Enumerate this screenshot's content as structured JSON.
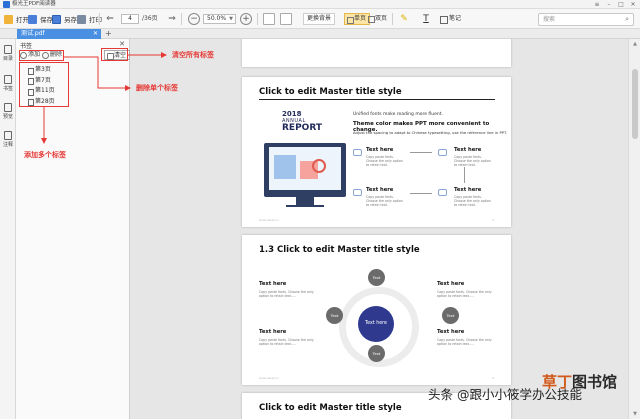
{
  "titlebar": {
    "title": "极光王PDF阅读器"
  },
  "toolbar": {
    "open_label": "打开",
    "save_label": "保存",
    "saveas_label": "另存",
    "print_label": "打印",
    "current_page": "4",
    "total_pages": "/36页",
    "zoom": "50.0%",
    "bg_label": "更换背景",
    "single_label": "单页",
    "double_label": "双页",
    "note_label": "笔记",
    "search_placeholder": "搜索"
  },
  "tabbar": {
    "tab_label": "测试.pdf"
  },
  "leftstrip": {
    "items": [
      "目录",
      "书签",
      "预览",
      "注释"
    ]
  },
  "bookmarks": {
    "title": "书签",
    "add_label": "添加",
    "delete_label": "删除",
    "clear_label": "清空",
    "items": [
      "第3页",
      "第7页",
      "第11页",
      "第28页"
    ]
  },
  "annotations": {
    "clear_all": "清空所有标签",
    "delete_single": "删除单个标签",
    "add_multiple": "添加多个标签"
  },
  "page1": {
    "title": "Click to edit Master title style",
    "annual_year": "2018",
    "annual_word": "ANNUAL",
    "report_word": "REPORT",
    "intro1": "Unified fonts make reading more fluent.",
    "intro2": "Theme color makes PPT more convenient to change.",
    "intro3": "Adjust the spacing to adapt to Chinese typesetting, use the reference line in PPT.",
    "items": [
      {
        "heading": "Text here",
        "body": "Copy paste fonts. Choose the only option to retain text."
      },
      {
        "heading": "Text here",
        "body": "Copy paste fonts. Choose the only option to retain text."
      },
      {
        "heading": "Text here",
        "body": "Copy paste fonts. Choose the only option to retain text."
      },
      {
        "heading": "Text here",
        "body": "Copy paste fonts. Choose the only option to retain text."
      }
    ],
    "footer_left": "www.islide.cc",
    "footer_right": "3"
  },
  "page2": {
    "title": "1.3 Click to edit Master title style",
    "center": "Text here",
    "node_label": "Text",
    "items": [
      {
        "heading": "Text here",
        "body": "Copy paste fonts. Choose the only option to retain text....."
      },
      {
        "heading": "Text here",
        "body": "Copy paste fonts. Choose the only option to retain text....."
      },
      {
        "heading": "Text here",
        "body": "Copy paste fonts. Choose the only option to retain text....."
      },
      {
        "heading": "Text here",
        "body": "Copy paste fonts. Choose the only option to retain text....."
      }
    ],
    "footer_left": "www.islide.cc",
    "footer_right": "4"
  },
  "page3": {
    "title": "Click to edit Master title style"
  },
  "watermark": {
    "text": "头条 @跟小小筱学办公技能",
    "logo_a": "草丁",
    "logo_b": "图书馆"
  },
  "colors": {
    "accent": "#4a90e2",
    "annotation": "#e53935",
    "hub": "#2f3a8f"
  }
}
